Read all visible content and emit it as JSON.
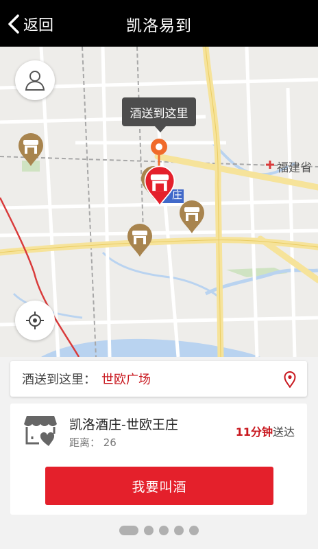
{
  "header": {
    "back_label": "返回",
    "title": "凯洛易到"
  },
  "map": {
    "tooltip": "酒送到这里",
    "place_label_fujian": "福建省",
    "place_label_zhuang": "庄",
    "controls": [
      "user-icon",
      "locate-icon"
    ]
  },
  "address": {
    "label": "酒送到这里：",
    "value": "世欧广场"
  },
  "store": {
    "name": "凯洛酒庄-世欧王庄",
    "distance": "距离： 26",
    "eta_time": "11分钟",
    "eta_suffix": "送达"
  },
  "order_button": "我要叫酒",
  "pager": {
    "pages": 5,
    "active": 1
  },
  "colors": {
    "brand_red": "#e4202b",
    "accent_red": "#c8161d",
    "store_pin_brown": "#a8844e",
    "location_orange": "#f06a2a"
  }
}
